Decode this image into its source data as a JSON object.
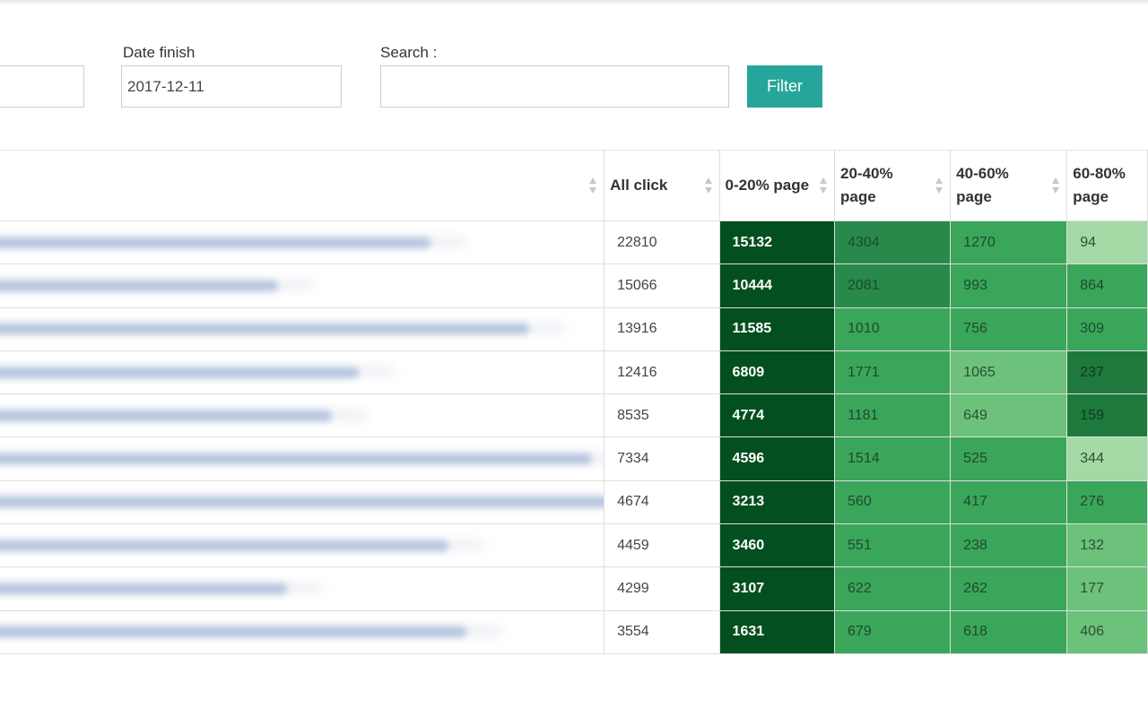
{
  "filters": {
    "date_finish_label": "Date finish",
    "date_finish_value": "2017-12-11",
    "search_label": "Search :",
    "search_value": "",
    "filter_button": "Filter"
  },
  "table": {
    "headers": [
      "",
      "All click",
      "0-20% page",
      "20-40% page",
      "40-60% page",
      "60-80% page"
    ],
    "rows": [
      {
        "all": "22810",
        "c1": "15132",
        "c2": "4304",
        "c3": "1270",
        "c4": "94"
      },
      {
        "all": "15066",
        "c1": "10444",
        "c2": "2081",
        "c3": "993",
        "c4": "864"
      },
      {
        "all": "13916",
        "c1": "11585",
        "c2": "1010",
        "c3": "756",
        "c4": "309"
      },
      {
        "all": "12416",
        "c1": "6809",
        "c2": "1771",
        "c3": "1065",
        "c4": "237"
      },
      {
        "all": "8535",
        "c1": "4774",
        "c2": "1181",
        "c3": "649",
        "c4": "159"
      },
      {
        "all": "7334",
        "c1": "4596",
        "c2": "1514",
        "c3": "525",
        "c4": "344"
      },
      {
        "all": "4674",
        "c1": "3213",
        "c2": "560",
        "c3": "417",
        "c4": "276"
      },
      {
        "all": "4459",
        "c1": "3460",
        "c2": "551",
        "c3": "238",
        "c4": "132"
      },
      {
        "all": "4299",
        "c1": "3107",
        "c2": "622",
        "c3": "262",
        "c4": "177"
      },
      {
        "all": "3554",
        "c1": "1631",
        "c2": "679",
        "c3": "618",
        "c4": "406"
      }
    ]
  }
}
